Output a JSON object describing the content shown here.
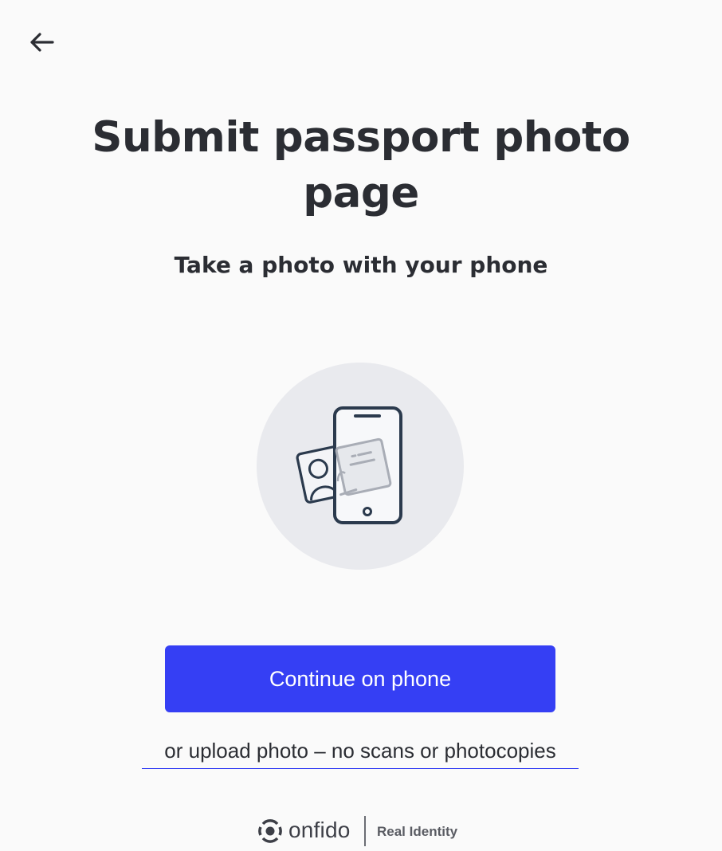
{
  "header": {
    "back_icon": "arrow-left-icon"
  },
  "main": {
    "title": "Submit passport photo page",
    "subtitle": "Take a photo with your phone",
    "illustration_icon": "phone-with-id-card-icon"
  },
  "actions": {
    "primary_label": "Continue on phone",
    "secondary_link": "or upload photo – no scans or photocopies"
  },
  "footer": {
    "brand": "onfido",
    "tagline": "Real Identity"
  },
  "colors": {
    "accent": "#353ff4",
    "text": "#2b2d33",
    "background": "#fafafa",
    "illustration_circle": "#e9eaee"
  }
}
